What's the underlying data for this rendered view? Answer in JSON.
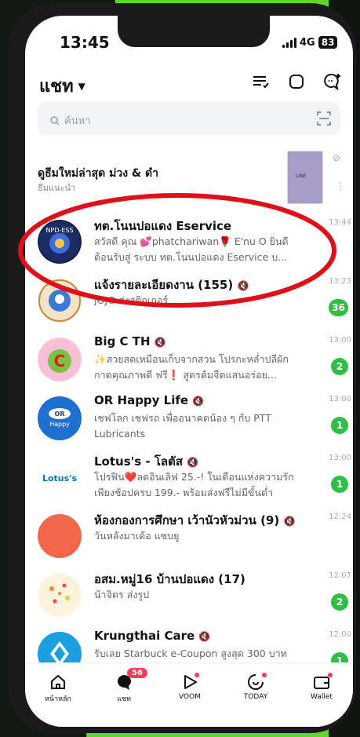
{
  "status_bar": {
    "time": "13:45",
    "network": "4G",
    "battery": "83"
  },
  "header": {
    "title": "แชท"
  },
  "search": {
    "placeholder": "ค้นหา"
  },
  "ad": {
    "title": "ดูธีมใหม่ล่าสุด ม่วง & ดำ",
    "subtitle": "ธีมแนะนำ",
    "image_label": "LINE"
  },
  "chats": [
    {
      "name": "ทต.โนนปอแดง Eservice",
      "preview": "สวัสดี คุณ 💕phatchariwan🌹 E'nu O ยินดีต้อนรับสู่ ระบบ ทต.โนนปอแดง Eservice บ...",
      "time": "13:44",
      "unread": "",
      "muted": false
    },
    {
      "name": "แจ้งรายละเอียดงาน (155)",
      "preview": "JOJO ส่งสติกเกอร์",
      "time": "13:23",
      "unread": "36",
      "muted": true
    },
    {
      "name": "Big C TH",
      "preview": "✨สวยสดเหมือนเก็บจากสวน โปรกะหล่ำปลีผักกาดคุณภาพดี ฟรี❗ สูตรต้มจืดแสนอร่อย...",
      "time": "13:00",
      "unread": "2",
      "muted": true
    },
    {
      "name": "OR Happy Life",
      "preview": "เชฟโลก เชฟรถ เพื่ออนาคตน้อง ๆ กับ PTT Lubricants",
      "time": "13:00",
      "unread": "1",
      "muted": true
    },
    {
      "name": "Lotus's - โลตัส",
      "preview": "โปรฟิน❤️ลดอินเลิฟ 25.-! ในเดือนแห่งความรัก เพียงช้อปครบ 199.- พร้อมส่งฟรีไม่มีขั้นต่ำ",
      "time": "13:00",
      "unread": "1",
      "muted": true
    },
    {
      "name": "ห้องกองการศึกษา เว้านัวหัวม่วน (9)",
      "preview": "วันหลังมาเด้อ แซบยู",
      "time": "12:24",
      "unread": "",
      "muted": true
    },
    {
      "name": "อสม.หมู่16 บ้านปอแดง (17)",
      "preview": "น้าจิตร ส่งรูป",
      "time": "12:07",
      "unread": "2",
      "muted": false
    },
    {
      "name": "Krungthai Care",
      "preview": "รับเลย Starbuck e-Coupon สูงสุด 300 บาท",
      "time": "12:00",
      "unread": "1",
      "muted": true
    }
  ],
  "tabs": [
    {
      "label": "หน้าหลัก",
      "icon": "home-icon"
    },
    {
      "label": "แชท",
      "icon": "chat-icon",
      "badge": "56"
    },
    {
      "label": "VOOM",
      "icon": "voom-icon"
    },
    {
      "label": "TODAY",
      "icon": "today-icon"
    },
    {
      "label": "Wallet",
      "icon": "wallet-icon"
    }
  ],
  "colors": {
    "accent": "#2fbf47",
    "badge": "#ff3b5c",
    "highlight": "#e0101a",
    "background_green": "#62d52a"
  }
}
